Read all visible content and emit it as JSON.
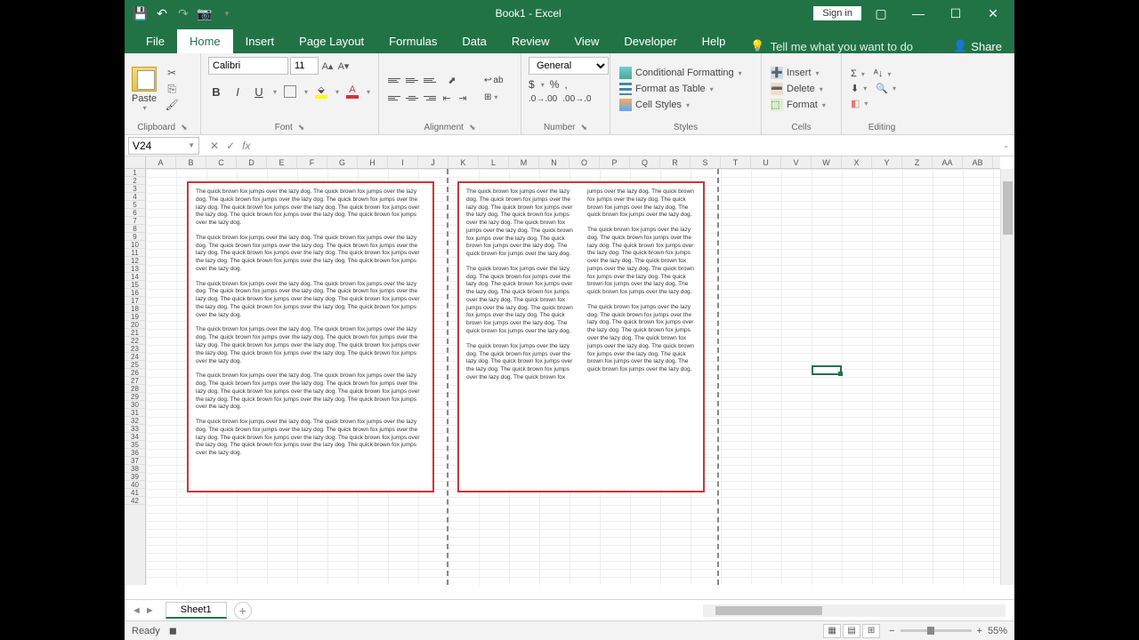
{
  "title": "Book1 - Excel",
  "signin": "Sign in",
  "tabs": [
    "File",
    "Home",
    "Insert",
    "Page Layout",
    "Formulas",
    "Data",
    "Review",
    "View",
    "Developer",
    "Help"
  ],
  "active_tab": "Home",
  "tell_me": "Tell me what you want to do",
  "share": "Share",
  "groups": {
    "clipboard": "Clipboard",
    "font": "Font",
    "alignment": "Alignment",
    "number": "Number",
    "styles": "Styles",
    "cells": "Cells",
    "editing": "Editing"
  },
  "paste": "Paste",
  "font_name": "Calibri",
  "font_size": "11",
  "number_format": "General",
  "cond_fmt": "Conditional Formatting",
  "fmt_table": "Format as Table",
  "cell_styles": "Cell Styles",
  "insert": "Insert",
  "delete": "Delete",
  "format": "Format",
  "bold": "B",
  "italic": "I",
  "under": "U",
  "namebox": "V24",
  "columns": [
    "A",
    "B",
    "C",
    "D",
    "E",
    "F",
    "G",
    "H",
    "I",
    "J",
    "K",
    "L",
    "M",
    "N",
    "O",
    "P",
    "Q",
    "R",
    "S",
    "T",
    "U",
    "V",
    "W",
    "X",
    "Y",
    "Z",
    "AA",
    "AB"
  ],
  "row_count": 42,
  "sheet": "Sheet1",
  "status": "Ready",
  "zoom": "55%",
  "sample_text": "The quick brown fox jumps over the lazy dog.  The quick brown fox jumps over the lazy dog.  The quick brown fox jumps over the lazy dog.  The quick brown fox jumps over the lazy dog.  The quick brown fox jumps over the lazy dog.  The quick brown fox jumps over the lazy dog.  The quick brown fox jumps over the lazy dog.  The quick brown fox jumps over the lazy dog.",
  "box1_paras": 6,
  "box2_paras": 5,
  "active_cell": {
    "col": "V",
    "row": 24
  }
}
